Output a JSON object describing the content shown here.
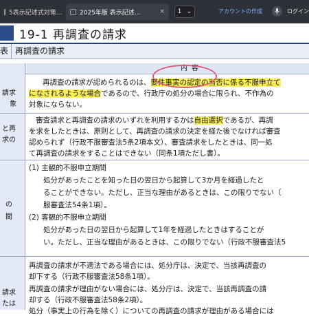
{
  "browser": {
    "tab1_label": "5表示記述式対策...",
    "tab2_label": "2025年版  表示記述...",
    "pager_current": "1",
    "pager_chevron": "⌄",
    "tab_close": "×",
    "create_account": "アカウントの作成",
    "mic_icon": "mic-icon",
    "login": "ログイン"
  },
  "section_title": "19-1  再調査の請求",
  "table_heading": {
    "left_fragment": "表",
    "label": "再調査の請求"
  },
  "header_label": "内容",
  "left_labels": {
    "row1": [
      "請求",
      "象"
    ],
    "row2": [
      "と再",
      "求の"
    ],
    "row3": [
      "の",
      "間"
    ],
    "row4": [
      "請求",
      "たは"
    ]
  },
  "content": {
    "row1": [
      {
        "pre": "再調査の請求が認められるのは、",
        "hl": "要件事実の認定の当否に係る不服申立て",
        "post": ""
      },
      {
        "pre": "",
        "hl": "になされるような場合",
        "post": "であるので、行政庁の処分の場合に限られ、不作為の"
      },
      {
        "pre": "対象にならない。",
        "hl": "",
        "post": ""
      }
    ],
    "row2": [
      {
        "pre": "審査請求と再調査の請求のいずれを利用するかは",
        "hl": "自由選択",
        "post": "であるが、再調"
      },
      {
        "pre": "を求をしたときは、原則として、再調査の請求の決定を経た後でなければ審査",
        "hl": "",
        "post": ""
      },
      {
        "pre": "認められず（行政不服審査法5条2項本文）、審査請求をしたときは、同一処",
        "hl": "",
        "post": ""
      },
      {
        "pre": "て再調査の請求をすることはできない（同条1項ただし書）。",
        "hl": "",
        "post": ""
      }
    ],
    "row3": [
      {
        "pre": "(1)  主観的不服申立期間",
        "hl": "",
        "post": ""
      },
      {
        "pre": "　　処分があったことを知った日の翌日から起算して3か月を経過したと",
        "hl": "",
        "post": ""
      },
      {
        "pre": "　　ることができない。ただし、正当な理由があるときは、この限りでない（",
        "hl": "",
        "post": ""
      },
      {
        "pre": "　　服審査法54条1項）。",
        "hl": "",
        "post": ""
      },
      {
        "pre": "(2)  客観的不服申立期間",
        "hl": "",
        "post": ""
      },
      {
        "pre": "　　処分があった日の翌日から起算して1年を経過したときはすることが",
        "hl": "",
        "post": ""
      },
      {
        "pre": "　　い。ただし、正当な理由があるときは、この限りでない（行政不服審査法5",
        "hl": "",
        "post": ""
      }
    ],
    "row4": [
      {
        "pre": "再調査の請求が不適法である場合には、処分庁は、決定で、当該再調査の",
        "hl": "",
        "post": ""
      },
      {
        "pre": "却下する（行政不服審査法58条1項）。",
        "hl": "",
        "post": ""
      },
      {
        "pre": "再調査の請求が理由がない場合には、処分庁は、決定で、当該再調査の請",
        "hl": "",
        "post": ""
      },
      {
        "pre": "却する（行政不服審査法58条2項）。",
        "hl": "",
        "post": ""
      },
      {
        "pre": "処分（事実上の行為を除く）についての再調査の請求が理由がある場合には",
        "hl": "",
        "post": ""
      }
    ]
  },
  "colors": {
    "topbar": "#2e3138",
    "title_accent": "#2b4b8c",
    "table_border": "#9aa7c4",
    "header_bg": "#dfe6f3",
    "highlight": "#fbef55",
    "circle": "#e05a7a"
  }
}
